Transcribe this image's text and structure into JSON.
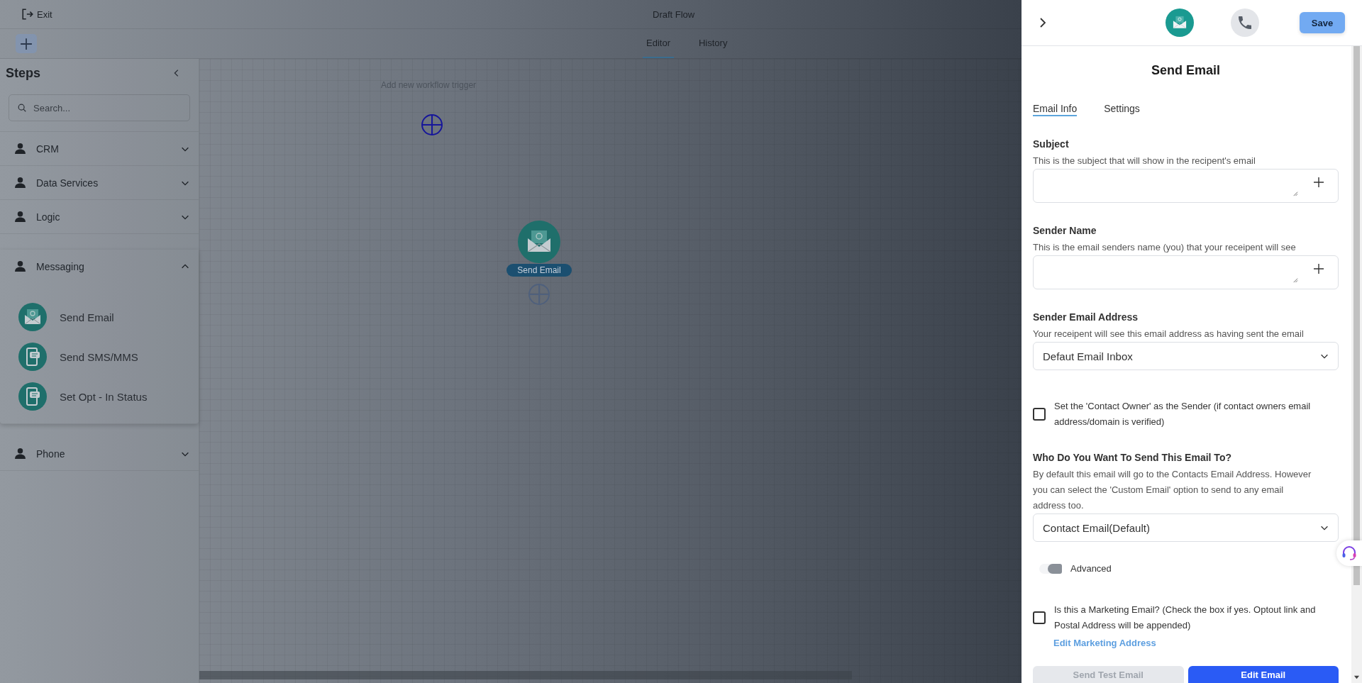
{
  "top_bar": {
    "exit": "Exit",
    "title": "Draft Flow"
  },
  "view_tabs": [
    {
      "label": "Editor",
      "selected": true
    },
    {
      "label": "History",
      "selected": false
    }
  ],
  "sidebar": {
    "title": "Steps",
    "search": {
      "placeholder": "Search..."
    },
    "categories": [
      {
        "label": "CRM",
        "expanded": false
      },
      {
        "label": "Data Services",
        "expanded": false
      },
      {
        "label": "Logic",
        "expanded": false
      },
      {
        "label": "Messaging",
        "expanded": true,
        "items": [
          {
            "label": "Send Email",
            "kind": "email"
          },
          {
            "label": "Send SMS/MMS",
            "kind": "sms"
          },
          {
            "label": "Set Opt - In Status",
            "kind": "sms"
          }
        ]
      },
      {
        "label": "Phone",
        "expanded": false
      }
    ]
  },
  "canvas": {
    "trigger_hint": "Add new workflow trigger",
    "nodes": [
      {
        "label": "Send Email",
        "kind": "email"
      }
    ]
  },
  "panel": {
    "node_tabs": [
      {
        "kind": "email",
        "selected": true
      },
      {
        "kind": "phone",
        "selected": false
      }
    ],
    "save": "Save",
    "title": "Send Email",
    "tabs": [
      {
        "label": "Email Info",
        "selected": true
      },
      {
        "label": "Settings",
        "selected": false
      }
    ],
    "fields": [
      {
        "kind": "text",
        "label": "Subject",
        "help": "This is the subject that will show in the recipent's email"
      },
      {
        "kind": "text",
        "label": "Sender Name",
        "help": "This is the email senders name (you) that your receipent will see"
      },
      {
        "kind": "select",
        "label": "Sender Email Address",
        "help": "Your receipent will see this email address as having sent the email",
        "value": "Defaut Email Inbox"
      },
      {
        "kind": "checkbox",
        "label": "Set the 'Contact Owner' as the Sender (if contact owners email address/domain is verified)",
        "checked": false
      },
      {
        "kind": "select",
        "label": "Who Do You Want To Send This Email To?",
        "help": "By default this email will go to the Contacts Email Address. However you can select the 'Custom Email' option to send to any email address too.",
        "value": "Contact Email(Default)"
      },
      {
        "kind": "toggle",
        "label": "Advanced",
        "on": false
      },
      {
        "kind": "checkbox",
        "label": "Is this a Marketing Email? (Check the box if yes. Optout link and Postal Address will be appended)",
        "checked": false,
        "link": "Edit Marketing Address"
      }
    ],
    "buttons": [
      {
        "label": "Send Test Email",
        "disabled": true
      },
      {
        "label": "Edit Email",
        "disabled": false
      }
    ]
  }
}
